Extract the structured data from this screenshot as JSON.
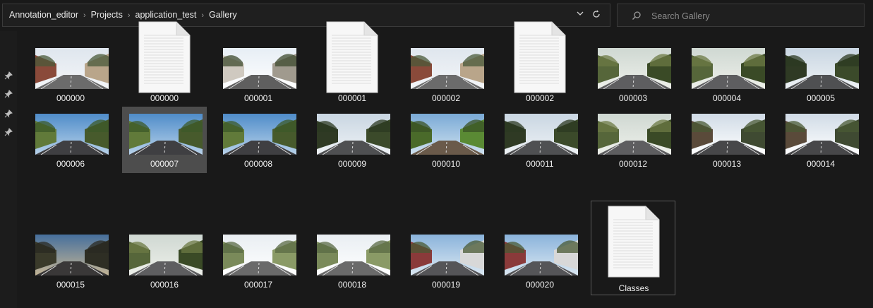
{
  "breadcrumb": [
    "Annotation_editor",
    "Projects",
    "application_test",
    "Gallery"
  ],
  "breadcrumb_separator": "›",
  "dropdown_icon": "chevron-down-icon",
  "refresh_icon": "refresh-icon",
  "search": {
    "placeholder": "Search Gallery",
    "value": ""
  },
  "files": [
    {
      "name": "000000",
      "type": "image",
      "scene": "street-buildings"
    },
    {
      "name": "000000",
      "type": "document"
    },
    {
      "name": "000001",
      "type": "image",
      "scene": "houses"
    },
    {
      "name": "000001",
      "type": "document"
    },
    {
      "name": "000002",
      "type": "image",
      "scene": "street-buildings"
    },
    {
      "name": "000002",
      "type": "document"
    },
    {
      "name": "000003",
      "type": "image",
      "scene": "tree-lined-road"
    },
    {
      "name": "000004",
      "type": "image",
      "scene": "tree-lined-road"
    },
    {
      "name": "000005",
      "type": "image",
      "scene": "forest-road"
    },
    {
      "name": "000006",
      "type": "image",
      "scene": "open-road"
    },
    {
      "name": "000007",
      "type": "image",
      "scene": "open-road",
      "selected": true
    },
    {
      "name": "000008",
      "type": "image",
      "scene": "open-road"
    },
    {
      "name": "000009",
      "type": "image",
      "scene": "forest-road"
    },
    {
      "name": "000010",
      "type": "image",
      "scene": "green-road"
    },
    {
      "name": "000011",
      "type": "image",
      "scene": "forest-road"
    },
    {
      "name": "000012",
      "type": "image",
      "scene": "tree-lined-road"
    },
    {
      "name": "000013",
      "type": "image",
      "scene": "parked-cars"
    },
    {
      "name": "000014",
      "type": "image",
      "scene": "parked-cars"
    },
    {
      "name": "000015",
      "type": "image",
      "scene": "dusk-road"
    },
    {
      "name": "000016",
      "type": "image",
      "scene": "tree-lined-road"
    },
    {
      "name": "000017",
      "type": "image",
      "scene": "bright-road"
    },
    {
      "name": "000018",
      "type": "image",
      "scene": "bright-road"
    },
    {
      "name": "000019",
      "type": "image",
      "scene": "bus-street"
    },
    {
      "name": "000020",
      "type": "image",
      "scene": "bus-street"
    },
    {
      "name": "Classes",
      "type": "document",
      "outlined": true
    }
  ],
  "colors": {
    "background": "#191919",
    "selection": "#4d4d4d",
    "text": "#f0f0f0"
  }
}
